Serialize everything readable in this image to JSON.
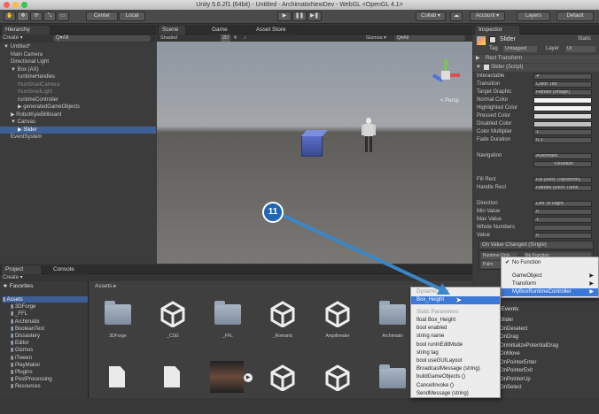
{
  "window": {
    "title": "Unity 5.6.2f1 (64bit) - Untitled - ArchimatixNewDev - WebGL <OpenGL 4.1>"
  },
  "toolbar": {
    "center": "Center",
    "local": "Local",
    "collab": "Collab ▾",
    "account": "Account ▾",
    "layers": "Layers",
    "layout": "Default"
  },
  "hierarchy": {
    "tab": "Hierarchy",
    "create": "Create ▾",
    "all": "Q▾All",
    "items": [
      {
        "label": "▼ Untitled*",
        "indent": 0,
        "dim": false
      },
      {
        "label": "Main Camera",
        "indent": 1,
        "dim": false
      },
      {
        "label": "Directional Light",
        "indent": 1,
        "dim": false
      },
      {
        "label": "▼ Box (AX)",
        "indent": 1,
        "dim": false
      },
      {
        "label": "runtimeHandles",
        "indent": 2,
        "dim": false
      },
      {
        "label": "thumbnailCamera",
        "indent": 2,
        "dim": true
      },
      {
        "label": "thumbnailLight",
        "indent": 2,
        "dim": true
      },
      {
        "label": "runtimeController",
        "indent": 2,
        "dim": false
      },
      {
        "label": "▶ generatedGameObjects",
        "indent": 2,
        "dim": false
      },
      {
        "label": "▶ RobotKyleBillboard",
        "indent": 1,
        "dim": false
      },
      {
        "label": "▼ Canvas",
        "indent": 1,
        "dim": false
      },
      {
        "label": "▶ Slider",
        "indent": 2,
        "dim": false,
        "selected": true
      },
      {
        "label": "EventSystem",
        "indent": 1,
        "dim": false
      }
    ]
  },
  "scene": {
    "tabs": [
      "Scene",
      "Game",
      "Asset Store"
    ],
    "shaded": "Shaded",
    "mode": "2D",
    "gizmos": "Gizmos ▾",
    "search": "Q▾All",
    "persp": "< Persp"
  },
  "inspector": {
    "tab": "Inspector",
    "object_name": "Slider",
    "static": "Static",
    "tag_label": "Tag",
    "tag": "Untagged",
    "layer_label": "Layer",
    "layer": "UI",
    "rect_transform": "Rect Transform",
    "slider_script": "Slider (Script)",
    "rows": [
      {
        "label": "Interactable",
        "value": "✔"
      },
      {
        "label": "Transition",
        "value": "Color Tint"
      },
      {
        "label": "Target Graphic",
        "value": "Handle (Image)"
      },
      {
        "label": "Normal Color",
        "value": ""
      },
      {
        "label": "Highlighted Color",
        "value": ""
      },
      {
        "label": "Pressed Color",
        "value": ""
      },
      {
        "label": "Disabled Color",
        "value": ""
      },
      {
        "label": "Color Multiplier",
        "value": "1"
      },
      {
        "label": "Fade Duration",
        "value": "0.1"
      },
      {
        "label": "Navigation",
        "value": "Automatic"
      },
      {
        "label": "",
        "value": "Visualize"
      },
      {
        "label": "Fill Rect",
        "value": "Fill (Rect Transform)"
      },
      {
        "label": "Handle Rect",
        "value": "Handle (Rect Trans"
      },
      {
        "label": "Direction",
        "value": "Left To Right"
      },
      {
        "label": "Min Value",
        "value": "0"
      },
      {
        "label": "Max Value",
        "value": "1"
      },
      {
        "label": "Whole Numbers",
        "value": ""
      },
      {
        "label": "Value",
        "value": "0"
      }
    ],
    "on_value_changed": "On Value Changed (Single)",
    "runtime_only": "Runtime Only",
    "no_function": "No Function"
  },
  "dropdown": {
    "items": [
      "No Function",
      "GameObject",
      "Transform",
      "MyBoxRuntimeController"
    ]
  },
  "submenu": {
    "dynamic_header": "Dynamic float",
    "dynamic_items": [
      "Box_Height"
    ],
    "static_header": "Static Parameters",
    "static_items": [
      "float Box_Height",
      "bool enabled",
      "string name",
      "bool runInEditMode",
      "string tag",
      "bool useGUILayout",
      "BroadcastMessage (string)",
      "buildGameObjects ()",
      "CancelInvoke ()",
      "SendMessage (string)"
    ]
  },
  "events": {
    "header": "d Events",
    "items": [
      "Slider",
      "OnDeselect",
      "OnDrag",
      "OnInitializePotentialDrag",
      "OnMove",
      "OnPointerEnter",
      "OnPointerExit",
      "OnPointerUp",
      "OnSelect"
    ]
  },
  "project": {
    "tabs": [
      "Project",
      "Console"
    ],
    "create": "Create ▾",
    "favorites": "Favorites",
    "tree": [
      "Assets",
      "3DForge",
      "_FFL",
      "Archimatix",
      "BooleanTest",
      "Dissastery",
      "Editor",
      "Gizmos",
      "iTween",
      "PlayMaker",
      "Plugins",
      "PostProcessing",
      "Resources"
    ],
    "breadcrumb": "Assets ▸",
    "row1": [
      {
        "label": "3DForge",
        "kind": "folder"
      },
      {
        "label": "_CSG",
        "kind": "unity"
      },
      {
        "label": "_FFL",
        "kind": "folder"
      },
      {
        "label": "_Romanic",
        "kind": "unity"
      },
      {
        "label": "Ampitheater",
        "kind": "unity"
      },
      {
        "label": "Archimatix",
        "kind": "folder"
      }
    ],
    "row2": [
      {
        "label": "",
        "kind": "doc"
      },
      {
        "label": "",
        "kind": "doc"
      },
      {
        "label": "",
        "kind": "video"
      },
      {
        "label": "",
        "kind": "unity"
      },
      {
        "label": "",
        "kind": "unity"
      },
      {
        "label": "",
        "kind": "folder"
      }
    ]
  },
  "annotation": {
    "badge": "11"
  }
}
